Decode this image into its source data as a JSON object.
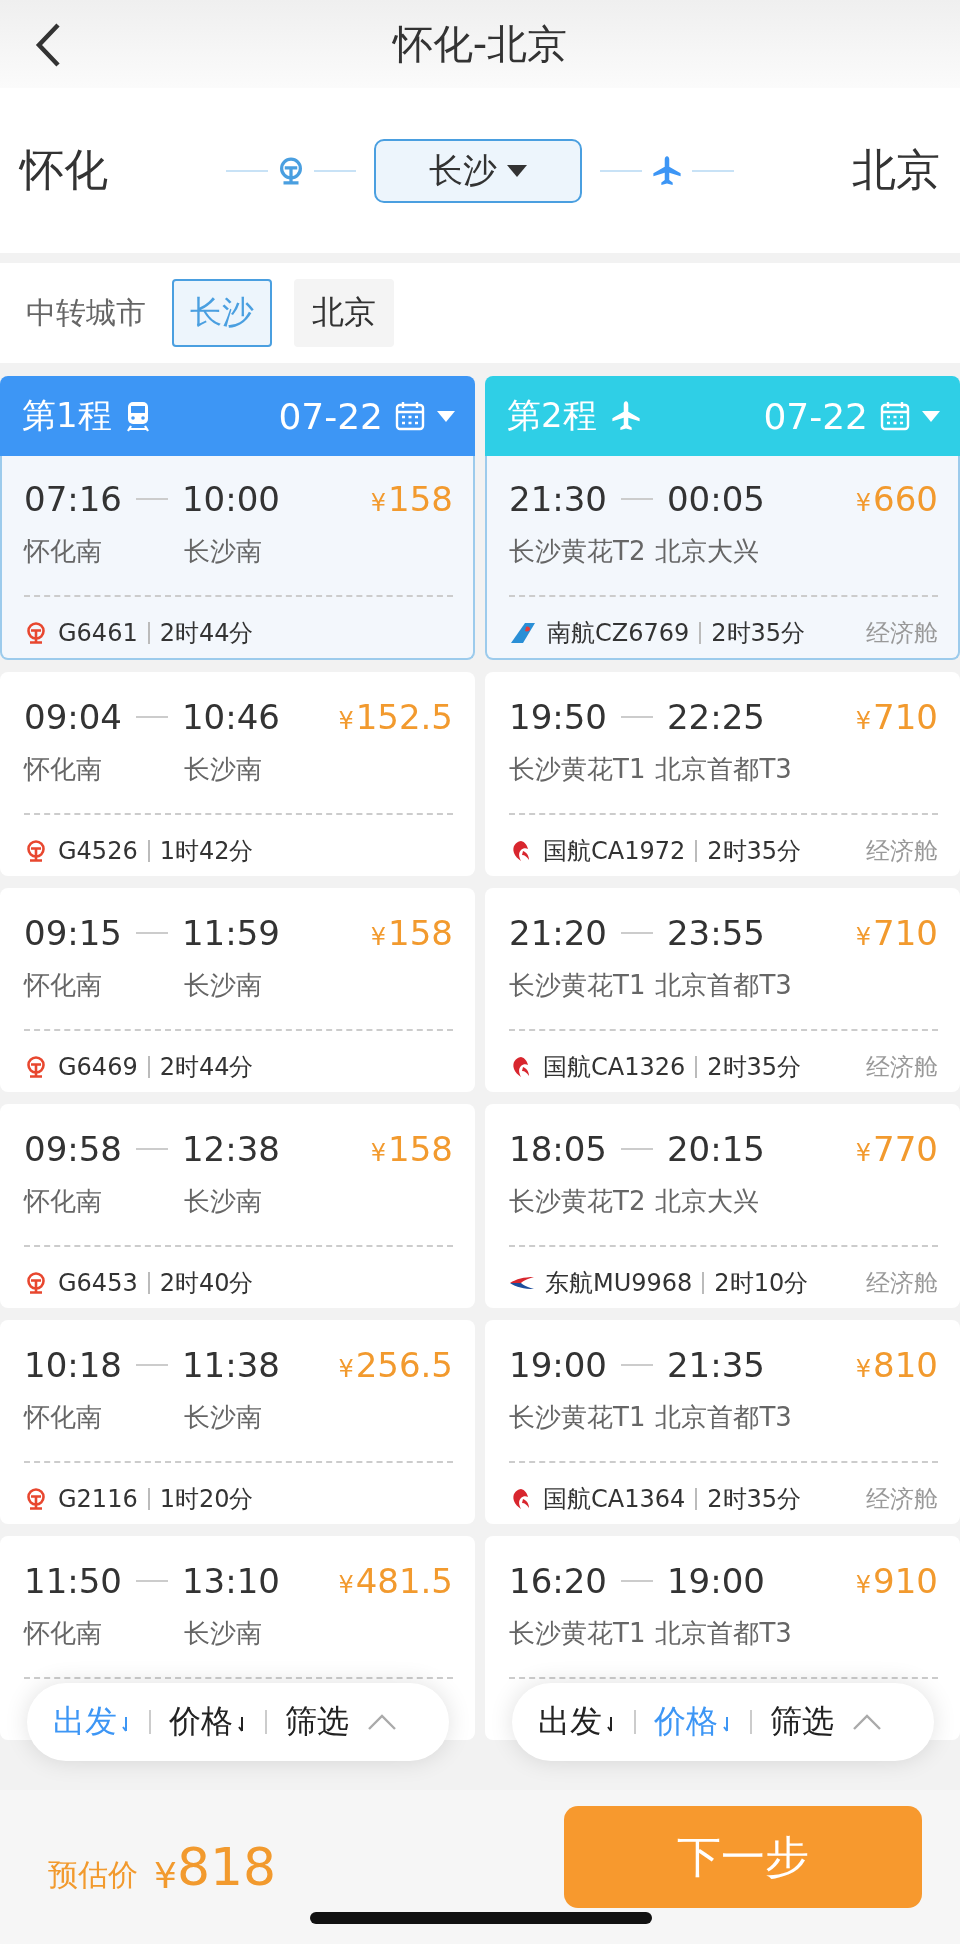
{
  "header": {
    "title": "怀化-北京"
  },
  "route": {
    "origin": "怀化",
    "transfer": "长沙",
    "destination": "北京"
  },
  "transit_cities": {
    "label": "中转城市",
    "options": [
      {
        "label": "长沙",
        "selected": true
      },
      {
        "label": "北京",
        "selected": false
      }
    ]
  },
  "legs": [
    {
      "label": "第1程",
      "kind": "train",
      "date": "07-22",
      "options": [
        {
          "depart": "07:16",
          "arrive": "10:00",
          "currency": "¥",
          "price": "158",
          "from": "怀化南",
          "to": "长沙南",
          "kind": "rail",
          "code": "G6461",
          "duration": "2时44分",
          "selected": true
        },
        {
          "depart": "09:04",
          "arrive": "10:46",
          "currency": "¥",
          "price": "152.5",
          "from": "怀化南",
          "to": "长沙南",
          "kind": "rail",
          "code": "G4526",
          "duration": "1时42分",
          "selected": false
        },
        {
          "depart": "09:15",
          "arrive": "11:59",
          "currency": "¥",
          "price": "158",
          "from": "怀化南",
          "to": "长沙南",
          "kind": "rail",
          "code": "G6469",
          "duration": "2时44分",
          "selected": false
        },
        {
          "depart": "09:58",
          "arrive": "12:38",
          "currency": "¥",
          "price": "158",
          "from": "怀化南",
          "to": "长沙南",
          "kind": "rail",
          "code": "G6453",
          "duration": "2时40分",
          "selected": false
        },
        {
          "depart": "10:18",
          "arrive": "11:38",
          "currency": "¥",
          "price": "256.5",
          "from": "怀化南",
          "to": "长沙南",
          "kind": "rail",
          "code": "G2116",
          "duration": "1时20分",
          "selected": false
        },
        {
          "depart": "11:50",
          "arrive": "13:10",
          "currency": "¥",
          "price": "481.5",
          "from": "怀化南",
          "to": "长沙南",
          "selected": false
        }
      ],
      "sort": [
        {
          "kind": "sort",
          "label": "出发",
          "selected": true
        },
        {
          "kind": "sort",
          "label": "价格",
          "selected": false
        },
        {
          "kind": "filter",
          "label": "筛选",
          "selected": false
        }
      ]
    },
    {
      "label": "第2程",
      "kind": "flight",
      "date": "07-22",
      "options": [
        {
          "depart": "21:30",
          "arrive": "00:05",
          "currency": "¥",
          "price": "660",
          "from": "长沙黄花T2",
          "to": "北京大兴",
          "kind": "tail",
          "code": "南航CZ6769",
          "duration": "2时35分",
          "cabin": "经济舱",
          "selected": true
        },
        {
          "depart": "19:50",
          "arrive": "22:25",
          "currency": "¥",
          "price": "710",
          "from": "长沙黄花T1",
          "to": "北京首都T3",
          "kind": "phoenix",
          "code": "国航CA1972",
          "duration": "2时35分",
          "cabin": "经济舱",
          "selected": false
        },
        {
          "depart": "21:20",
          "arrive": "23:55",
          "currency": "¥",
          "price": "710",
          "from": "长沙黄花T1",
          "to": "北京首都T3",
          "kind": "phoenix",
          "code": "国航CA1326",
          "duration": "2时35分",
          "cabin": "经济舱",
          "selected": false
        },
        {
          "depart": "18:05",
          "arrive": "20:15",
          "currency": "¥",
          "price": "770",
          "from": "长沙黄花T2",
          "to": "北京大兴",
          "kind": "swallow",
          "code": "东航MU9968",
          "duration": "2时10分",
          "cabin": "经济舱",
          "selected": false
        },
        {
          "depart": "19:00",
          "arrive": "21:35",
          "currency": "¥",
          "price": "810",
          "from": "长沙黄花T1",
          "to": "北京首都T3",
          "kind": "phoenix",
          "code": "国航CA1364",
          "duration": "2时35分",
          "cabin": "经济舱",
          "selected": false
        },
        {
          "depart": "16:20",
          "arrive": "19:00",
          "currency": "¥",
          "price": "910",
          "from": "长沙黄花T1",
          "to": "北京首都T3",
          "selected": false
        }
      ],
      "sort": [
        {
          "kind": "sort",
          "label": "出发",
          "selected": false
        },
        {
          "kind": "sort",
          "label": "价格",
          "selected": true
        },
        {
          "kind": "filter",
          "label": "筛选",
          "selected": false
        }
      ]
    }
  ],
  "footer": {
    "label": "预估价",
    "currency": "¥",
    "amount": "818",
    "button": "下一步"
  }
}
